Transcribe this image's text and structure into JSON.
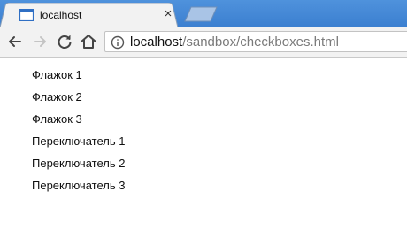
{
  "tab": {
    "title": "localhost",
    "close_symbol": "×",
    "favicon": "page-icon"
  },
  "toolbar": {
    "back_icon": "arrow-left-icon",
    "forward_icon": "arrow-right-icon",
    "reload_icon": "reload-icon",
    "home_icon": "home-icon",
    "info_icon": "info-icon"
  },
  "address": {
    "host": "localhost",
    "path": "/sandbox/checkboxes.html"
  },
  "page": {
    "items": [
      "Флажок 1",
      "Флажок 2",
      "Флажок 3",
      "Переключатель 1",
      "Переключатель 2",
      "Переключатель 3"
    ]
  },
  "colors": {
    "tabstrip": "#3b7fd0",
    "toolbar": "#f2f2f2",
    "url_path": "#7a7a7a"
  }
}
